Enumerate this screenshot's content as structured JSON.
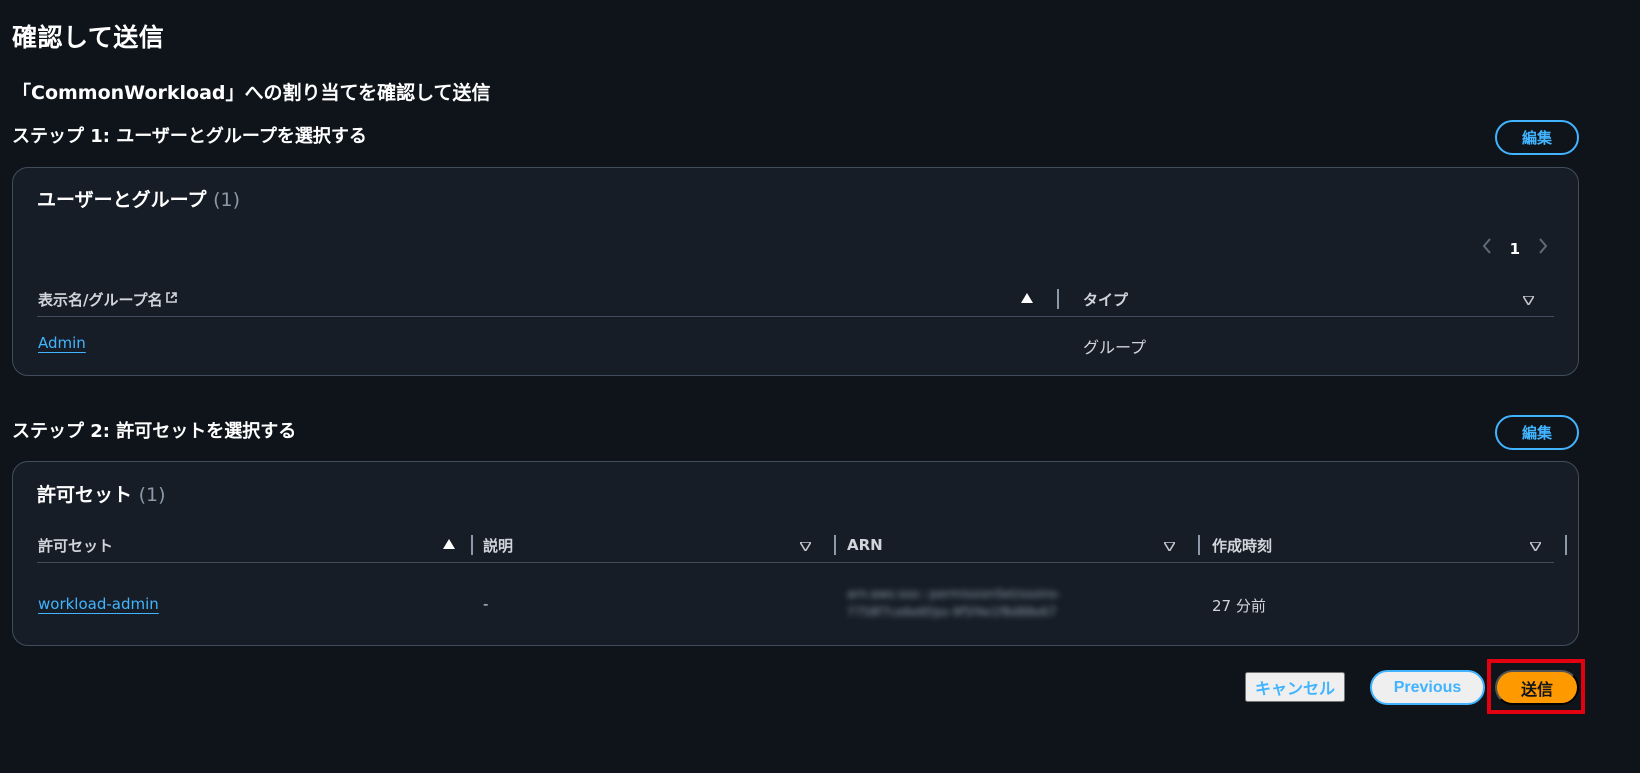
{
  "page": {
    "title": "確認して送信",
    "subtitle": "「CommonWorkload」への割り当てを確認して送信"
  },
  "step1": {
    "heading": "ステップ 1: ユーザーとグループを選択する",
    "edit_label": "編集",
    "container_title": "ユーザーとグループ",
    "count": "(1)",
    "pagination": {
      "current_page": "1",
      "prev_icon": "chevron-left-icon",
      "next_icon": "chevron-right-icon"
    },
    "columns": [
      {
        "label": "表示名/グループ名",
        "sort": "ascending"
      },
      {
        "label": "タイプ",
        "sort": "none"
      }
    ],
    "rows": [
      {
        "name": "Admin",
        "type": "グループ"
      }
    ]
  },
  "step2": {
    "heading": "ステップ 2: 許可セットを選択する",
    "edit_label": "編集",
    "container_title": "許可セット",
    "count": "(1)",
    "columns": [
      {
        "label": "許可セット",
        "sort": "ascending"
      },
      {
        "label": "説明",
        "sort": "none"
      },
      {
        "label": "ARN",
        "sort": "none"
      },
      {
        "label": "作成時刻",
        "sort": "none"
      }
    ],
    "rows": [
      {
        "name": "workload-admin",
        "description": "-",
        "arn_line1": "arn:aws:sso:::permissionSet/ssoins-",
        "arn_line2": "7758f7ce6e6f/ps-9f5f4e1f8d88e67",
        "created": "27 分前"
      }
    ]
  },
  "footer": {
    "cancel_label": "キャンセル",
    "previous_label": "Previous",
    "submit_label": "送信"
  },
  "colors": {
    "background": "#0f141a",
    "container": "#161d26",
    "accent": "#42b4ff",
    "primary_button": "#ff9900",
    "highlight": "#e3000f"
  }
}
